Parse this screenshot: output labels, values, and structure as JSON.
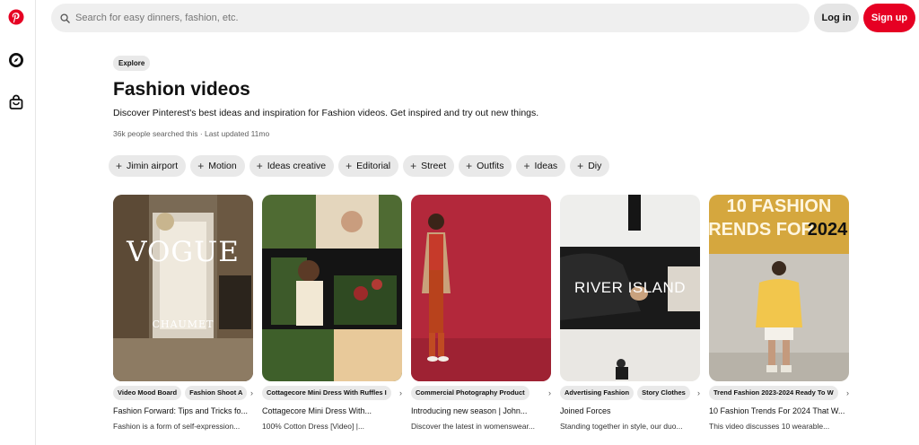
{
  "colors": {
    "brand": "#e60023",
    "chip_bg": "#e9e9e9",
    "search_bg": "#efefef"
  },
  "sidebar": {
    "icons": [
      "pinterest-logo-icon",
      "compass-icon",
      "shopping-bag-icon"
    ]
  },
  "header": {
    "search_placeholder": "Search for easy dinners, fashion, etc.",
    "login_label": "Log in",
    "signup_label": "Sign up"
  },
  "page": {
    "badge": "Explore",
    "title": "Fashion videos",
    "description": "Discover Pinterest's best ideas and inspiration for Fashion videos. Get inspired and try out new things.",
    "meta": "36k people searched this · Last updated 11mo"
  },
  "chips": [
    "Jimin airport",
    "Motion",
    "Ideas creative",
    "Editorial",
    "Street",
    "Outfits",
    "Ideas",
    "Diy"
  ],
  "pins": [
    {
      "image_text": [
        "VOGUE",
        "CHAUMET"
      ],
      "tags": [
        "Video Mood Board",
        "Fashion Shoot A"
      ],
      "title": "Fashion Forward: Tips and Tricks fo...",
      "subtitle": "Fashion is a form of self-expression..."
    },
    {
      "image_text": [],
      "tags": [
        "Cottagecore Mini Dress With Ruffles I"
      ],
      "title": "Cottagecore Mini Dress With...",
      "subtitle": "100% Cotton Dress [Video] |..."
    },
    {
      "image_text": [],
      "tags": [
        "Commercial Photography Product"
      ],
      "title": "Introducing new season | John...",
      "subtitle": "Discover the latest in womenswear..."
    },
    {
      "image_text": [
        "RIVER ISLAND"
      ],
      "tags": [
        "Advertising Fashion",
        "Story Clothes"
      ],
      "title": "Joined Forces",
      "subtitle": "Standing together in style, our duo..."
    },
    {
      "image_text": [
        "10 FASHION",
        "TRENDS FOR",
        "2024"
      ],
      "tags": [
        "Trend Fashion 2023-2024 Ready To W"
      ],
      "title": "10 Fashion Trends For 2024 That W...",
      "subtitle": "This video discusses 10 wearable..."
    }
  ],
  "arrow_glyph": "›"
}
